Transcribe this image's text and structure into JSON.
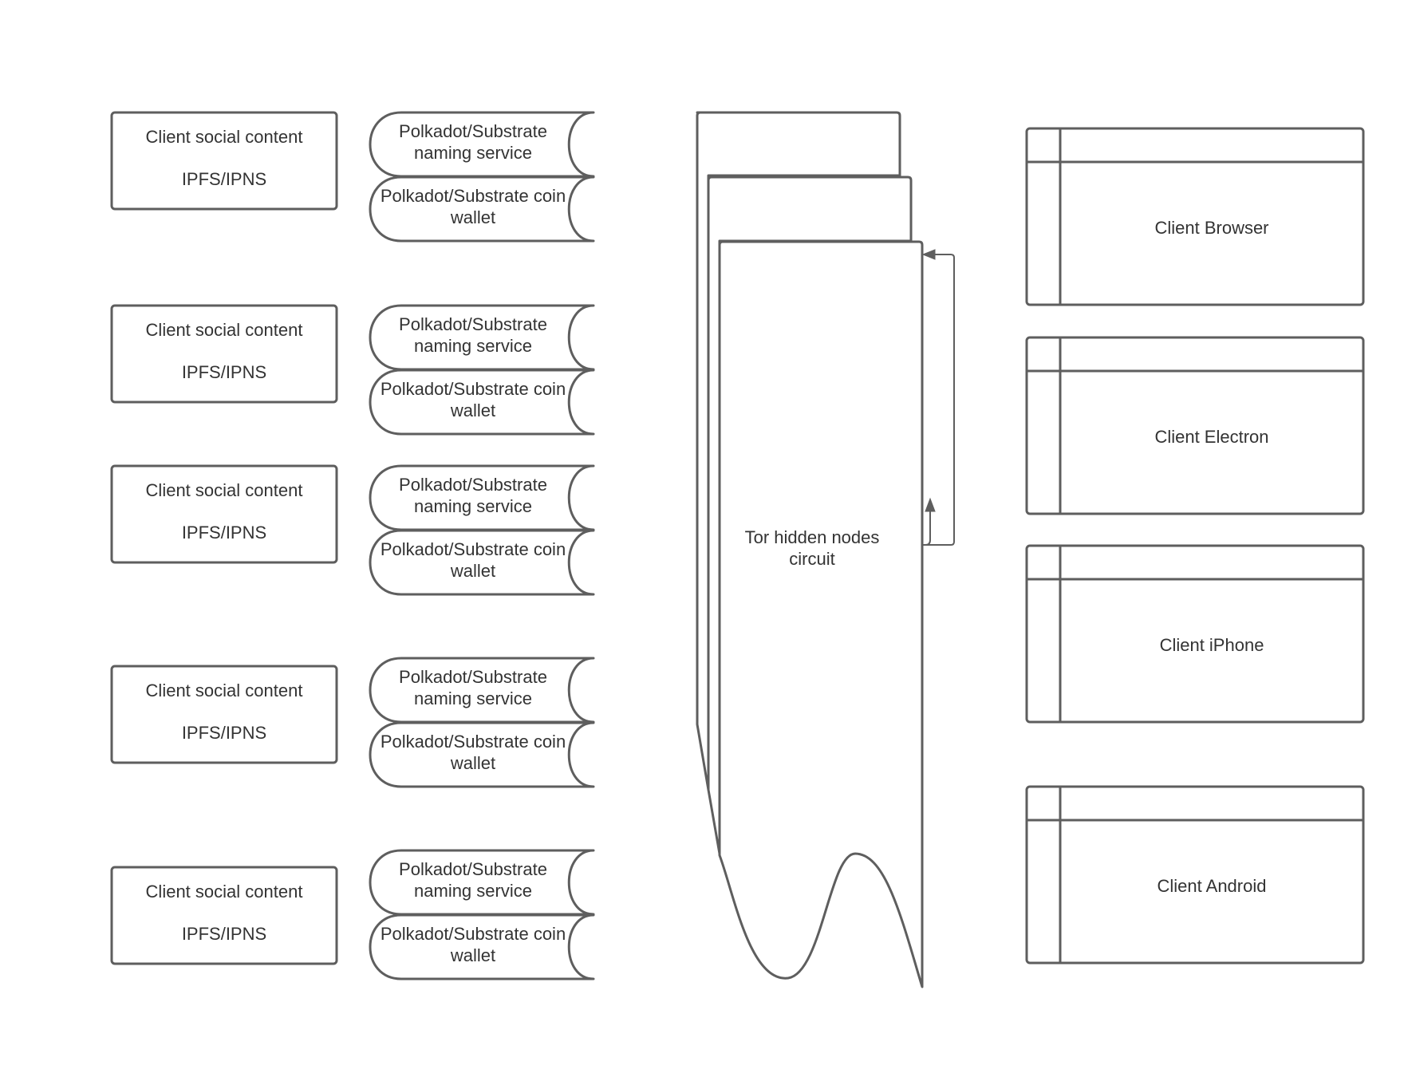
{
  "diagram": {
    "client_groups": [
      {
        "content_line1": "Client social content",
        "content_line2": "IPFS/IPNS",
        "naming_line1": "Polkadot/Substrate",
        "naming_line2": "naming service",
        "wallet_line1": "Polkadot/Substrate coin",
        "wallet_line2": "wallet"
      },
      {
        "content_line1": "Client social content",
        "content_line2": "IPFS/IPNS",
        "naming_line1": "Polkadot/Substrate",
        "naming_line2": "naming service",
        "wallet_line1": "Polkadot/Substrate coin",
        "wallet_line2": "wallet"
      },
      {
        "content_line1": "Client social content",
        "content_line2": "IPFS/IPNS",
        "naming_line1": "Polkadot/Substrate",
        "naming_line2": "naming service",
        "wallet_line1": "Polkadot/Substrate coin",
        "wallet_line2": "wallet"
      },
      {
        "content_line1": "Client social content",
        "content_line2": "IPFS/IPNS",
        "naming_line1": "Polkadot/Substrate",
        "naming_line2": "naming service",
        "wallet_line1": "Polkadot/Substrate coin",
        "wallet_line2": "wallet"
      },
      {
        "content_line1": "Client social content",
        "content_line2": "IPFS/IPNS",
        "naming_line1": "Polkadot/Substrate",
        "naming_line2": "naming service",
        "wallet_line1": "Polkadot/Substrate coin",
        "wallet_line2": "wallet"
      }
    ],
    "tor": {
      "line1": "Tor hidden nodes",
      "line2": "circuit"
    },
    "clients": [
      {
        "label": "Client Browser"
      },
      {
        "label": "Client Electron"
      },
      {
        "label": "Client iPhone"
      },
      {
        "label": "Client Android"
      }
    ]
  }
}
